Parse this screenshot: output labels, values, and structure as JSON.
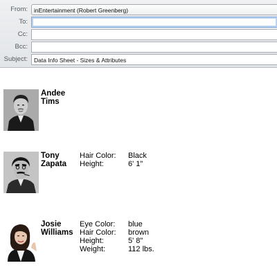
{
  "header": {
    "from_label": "From:",
    "from_value": "inEntertainment (Robert Greenberg)",
    "to_label": "To:",
    "to_value": "",
    "cc_label": "Cc:",
    "cc_value": "",
    "bcc_label": "Bcc:",
    "bcc_value": "",
    "subject_label": "Subject:",
    "subject_value": "Data Info Sheet - Sizes & Attributes"
  },
  "contacts": [
    {
      "first": "Andee",
      "last": "Tims",
      "attributes": []
    },
    {
      "first": "Tony",
      "last": "Zapata",
      "attributes": [
        {
          "label": "Hair Color:",
          "value": "Black"
        },
        {
          "label": "Height:",
          "value": "6' 1\""
        }
      ]
    },
    {
      "first": "Josie",
      "last": "Williams",
      "attributes": [
        {
          "label": "Eye Color:",
          "value": "blue"
        },
        {
          "label": "Hair Color:",
          "value": "brown"
        },
        {
          "label": "Height:",
          "value": "5' 8\""
        },
        {
          "label": "Weight:",
          "value": "112 lbs."
        }
      ]
    }
  ]
}
